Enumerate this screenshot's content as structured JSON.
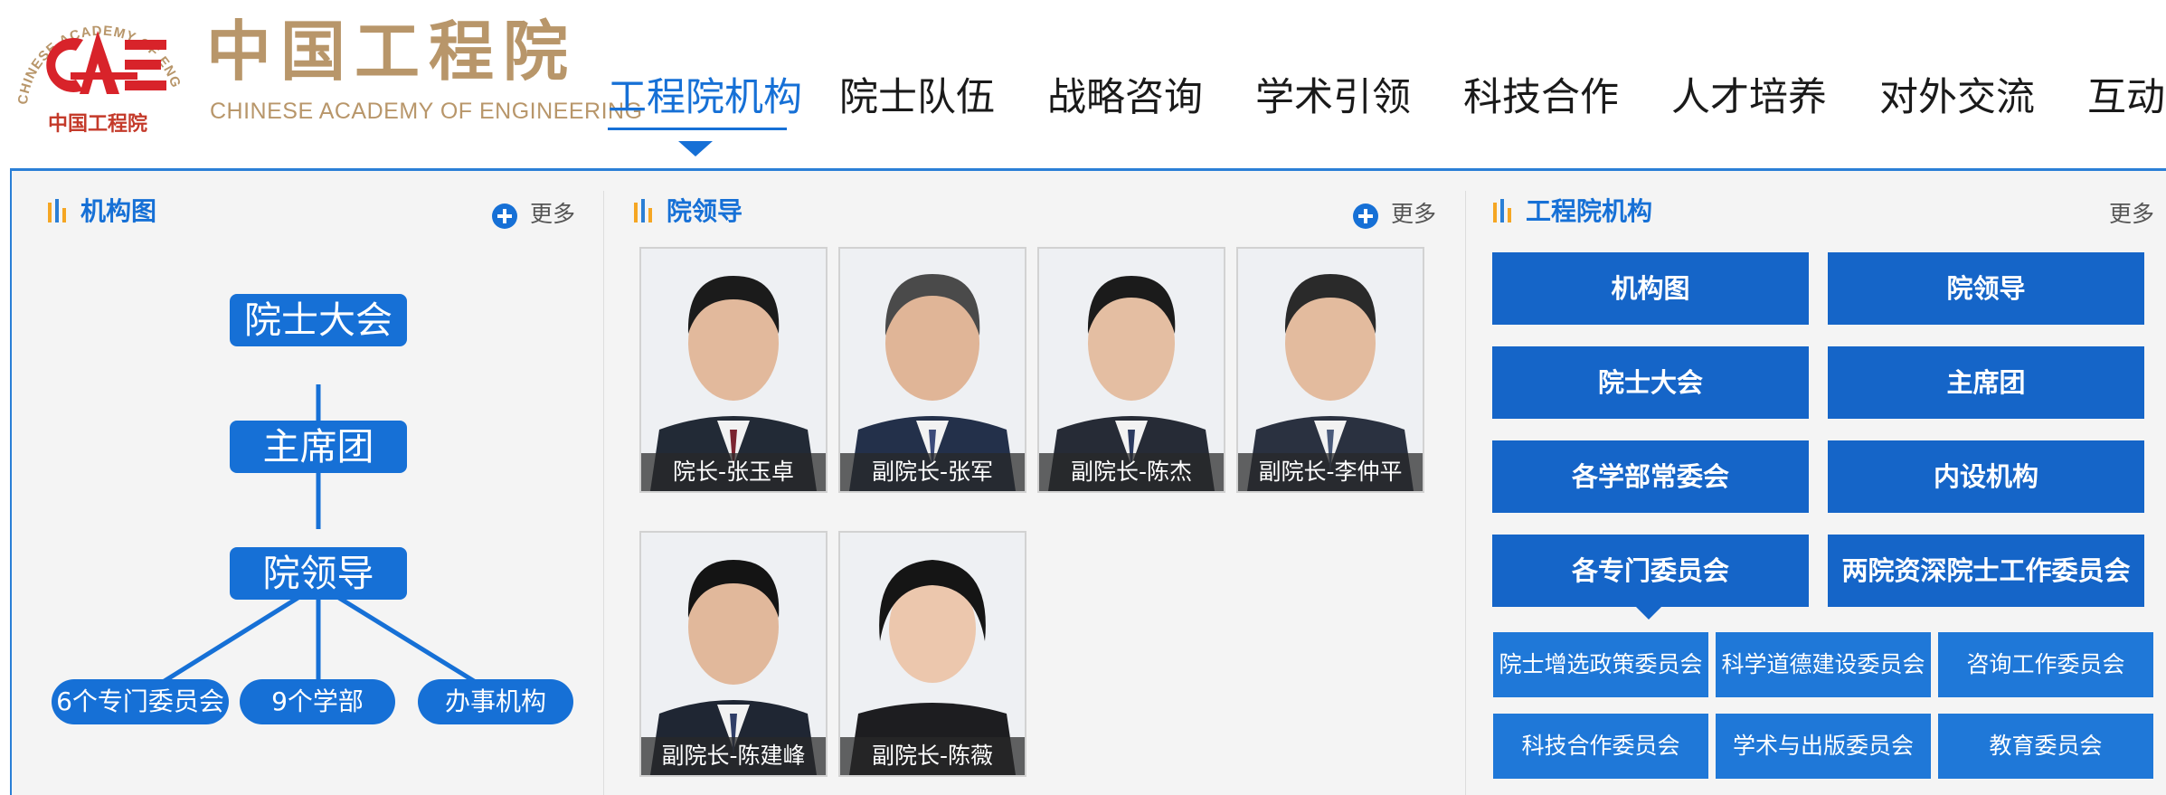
{
  "header": {
    "logo_cn": "中国工程院",
    "logo_en": "CHINESE ACADEMY OF ENGINEERING",
    "emblem_ring_text": "CHINESE ACADEMY OF ENGINEERING",
    "emblem_bottom_text": "中国工程院",
    "brand_color": "#b8966a",
    "accent_color": "#1670d6"
  },
  "nav": {
    "items": [
      {
        "label": "工程院机构",
        "active": true
      },
      {
        "label": "院士队伍",
        "active": false
      },
      {
        "label": "战略咨询",
        "active": false
      },
      {
        "label": "学术引领",
        "active": false
      },
      {
        "label": "科技合作",
        "active": false
      },
      {
        "label": "人才培养",
        "active": false
      },
      {
        "label": "对外交流",
        "active": false
      },
      {
        "label": "互动交流",
        "active": false
      }
    ]
  },
  "org_section": {
    "title": "机构图",
    "more": "更多",
    "nodes": [
      "院士大会",
      "主席团",
      "院领导"
    ],
    "leaves": [
      "6个专门委员会",
      "9个学部",
      "办事机构"
    ]
  },
  "leaders_section": {
    "title": "院领导",
    "more": "更多",
    "leaders": [
      {
        "caption": "院长-张玉卓"
      },
      {
        "caption": "副院长-张军"
      },
      {
        "caption": "副院长-陈杰"
      },
      {
        "caption": "副院长-李仲平"
      },
      {
        "caption": "副院长-陈建峰"
      },
      {
        "caption": "副院长-陈薇"
      }
    ]
  },
  "institutions_section": {
    "title": "工程院机构",
    "more": "更多",
    "buttons": [
      "机构图",
      "院领导",
      "院士大会",
      "主席团",
      "各学部常委会",
      "内设机构",
      "各专门委员会",
      "两院资深院士工作委员会"
    ],
    "sub_buttons": [
      "院士增选政策委员会",
      "科学道德建设委员会",
      "咨询工作委员会",
      "科技合作委员会",
      "学术与出版委员会",
      "教育委员会"
    ]
  }
}
